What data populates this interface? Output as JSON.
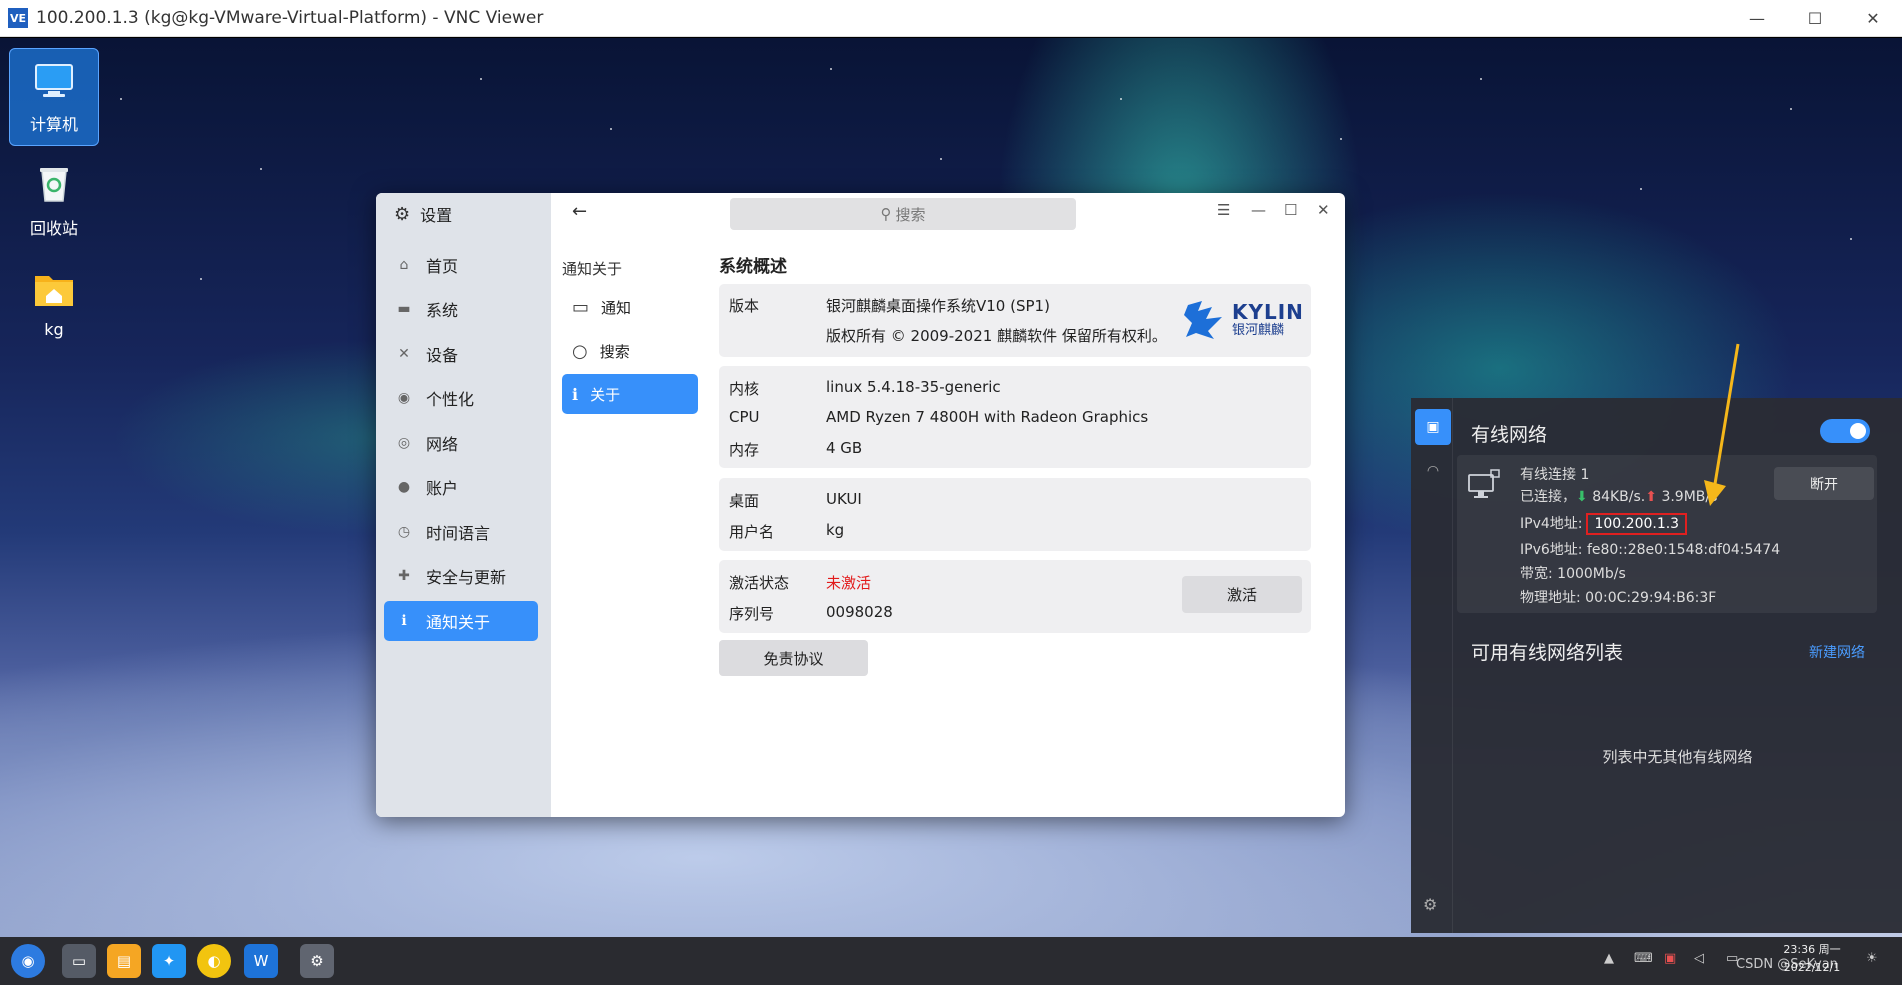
{
  "vnc": {
    "logo": "VE",
    "title": "100.200.1.3 (kg@kg-VMware-Virtual-Platform) - VNC Viewer",
    "minimize": "—",
    "maximize": "☐",
    "close": "✕"
  },
  "desktop": {
    "icons": [
      {
        "label": "计算机",
        "icon": "computer-icon"
      },
      {
        "label": "回收站",
        "icon": "trash-icon"
      },
      {
        "label": "kg",
        "icon": "home-folder-icon"
      }
    ]
  },
  "settings": {
    "header": "设置",
    "sidebar": [
      {
        "label": "首页",
        "icon": "home-icon"
      },
      {
        "label": "系统",
        "icon": "monitor-icon"
      },
      {
        "label": "设备",
        "icon": "tools-icon"
      },
      {
        "label": "个性化",
        "icon": "palette-icon"
      },
      {
        "label": "网络",
        "icon": "globe-icon"
      },
      {
        "label": "账户",
        "icon": "user-icon"
      },
      {
        "label": "时间语言",
        "icon": "clock-icon"
      },
      {
        "label": "安全与更新",
        "icon": "shield-icon"
      },
      {
        "label": "通知关于",
        "icon": "info-icon",
        "active": true
      }
    ],
    "search_placeholder": "搜索",
    "sub_title": "通知关于",
    "sub_items": [
      {
        "label": "通知",
        "icon": "chat-icon"
      },
      {
        "label": "搜索",
        "icon": "search-icon"
      },
      {
        "label": "关于",
        "icon": "info-icon",
        "active": true
      }
    ],
    "section_title": "系统概述",
    "version_label": "版本",
    "version_value": "银河麒麟桌面操作系统V10 (SP1)",
    "copyright": "版权所有 © 2009-2021 麒麟软件 保留所有权利。",
    "logo_text": "KYLIN",
    "logo_sub": "银河麒麟",
    "kernel_label": "内核",
    "kernel_value": "linux 5.4.18-35-generic",
    "cpu_label": "CPU",
    "cpu_value": "AMD Ryzen 7 4800H with Radeon Graphics",
    "mem_label": "内存",
    "mem_value": "4 GB",
    "desktop_label": "桌面",
    "desktop_value": "UKUI",
    "user_label": "用户名",
    "user_value": "kg",
    "activation_label": "激活状态",
    "activation_value": "未激活",
    "serial_label": "序列号",
    "serial_value": "0098028",
    "activate_button": "激活",
    "disclaimer_button": "免责协议"
  },
  "network": {
    "title": "有线网络",
    "toggle_on": true,
    "connection_name": "有线连接 1",
    "status_prefix": "已连接，",
    "down_arrow": "⬇",
    "down_speed": "84KB/s.",
    "up_arrow": "⬆",
    "up_speed": "3.9MB/s",
    "disconnect_button": "断开",
    "ipv4_label": "IPv4地址:",
    "ipv4_value": "100.200.1.3",
    "ipv6_label": "IPv6地址:",
    "ipv6_value": "fe80::28e0:1548:df04:5474",
    "bandwidth_label": "带宽:",
    "bandwidth_value": "1000Mb/s",
    "mac_label": "物理地址:",
    "mac_value": "00:0C:29:94:B6:3F",
    "available_title": "可用有线网络列表",
    "new_network": "新建网络",
    "empty_message": "列表中无其他有线网络"
  },
  "taskbar": {
    "clock_time": "23:36 周一",
    "clock_date": "2022/12/1",
    "watermark": "CSDN @SeKyan"
  },
  "colors": {
    "accent": "#3790fa",
    "inactive_red": "#e21a1a",
    "highlight_box": "#e02020"
  }
}
